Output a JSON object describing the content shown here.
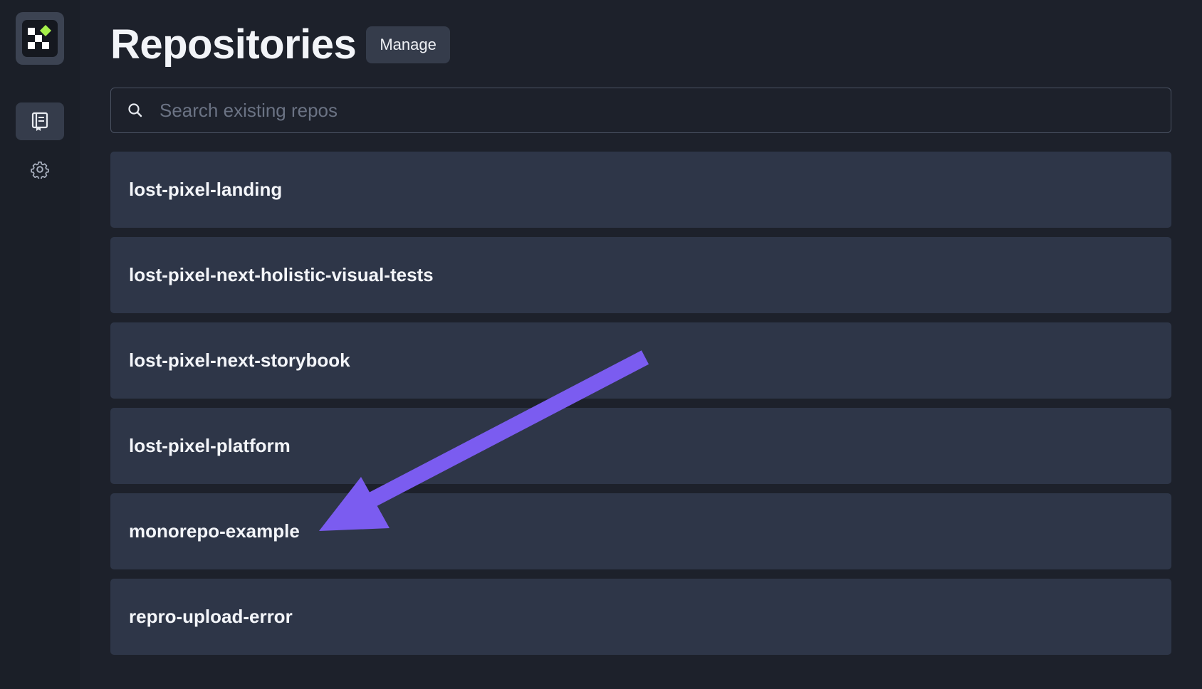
{
  "header": {
    "title": "Repositories",
    "manage_label": "Manage"
  },
  "search": {
    "placeholder": "Search existing repos",
    "value": ""
  },
  "sidebar": {
    "items": [
      {
        "icon": "repository-icon",
        "active": true
      },
      {
        "icon": "gear-icon",
        "active": false
      }
    ]
  },
  "repos": [
    {
      "name": "lost-pixel-landing"
    },
    {
      "name": "lost-pixel-next-holistic-visual-tests"
    },
    {
      "name": "lost-pixel-next-storybook"
    },
    {
      "name": "lost-pixel-platform"
    },
    {
      "name": "monorepo-example"
    },
    {
      "name": "repro-upload-error"
    }
  ],
  "annotation": {
    "arrow_color": "#7b5cf0",
    "points_to": "monorepo-example"
  },
  "colors": {
    "background": "#1d212b",
    "card": "#2e3648",
    "logo_accent": "#a6f04a"
  }
}
